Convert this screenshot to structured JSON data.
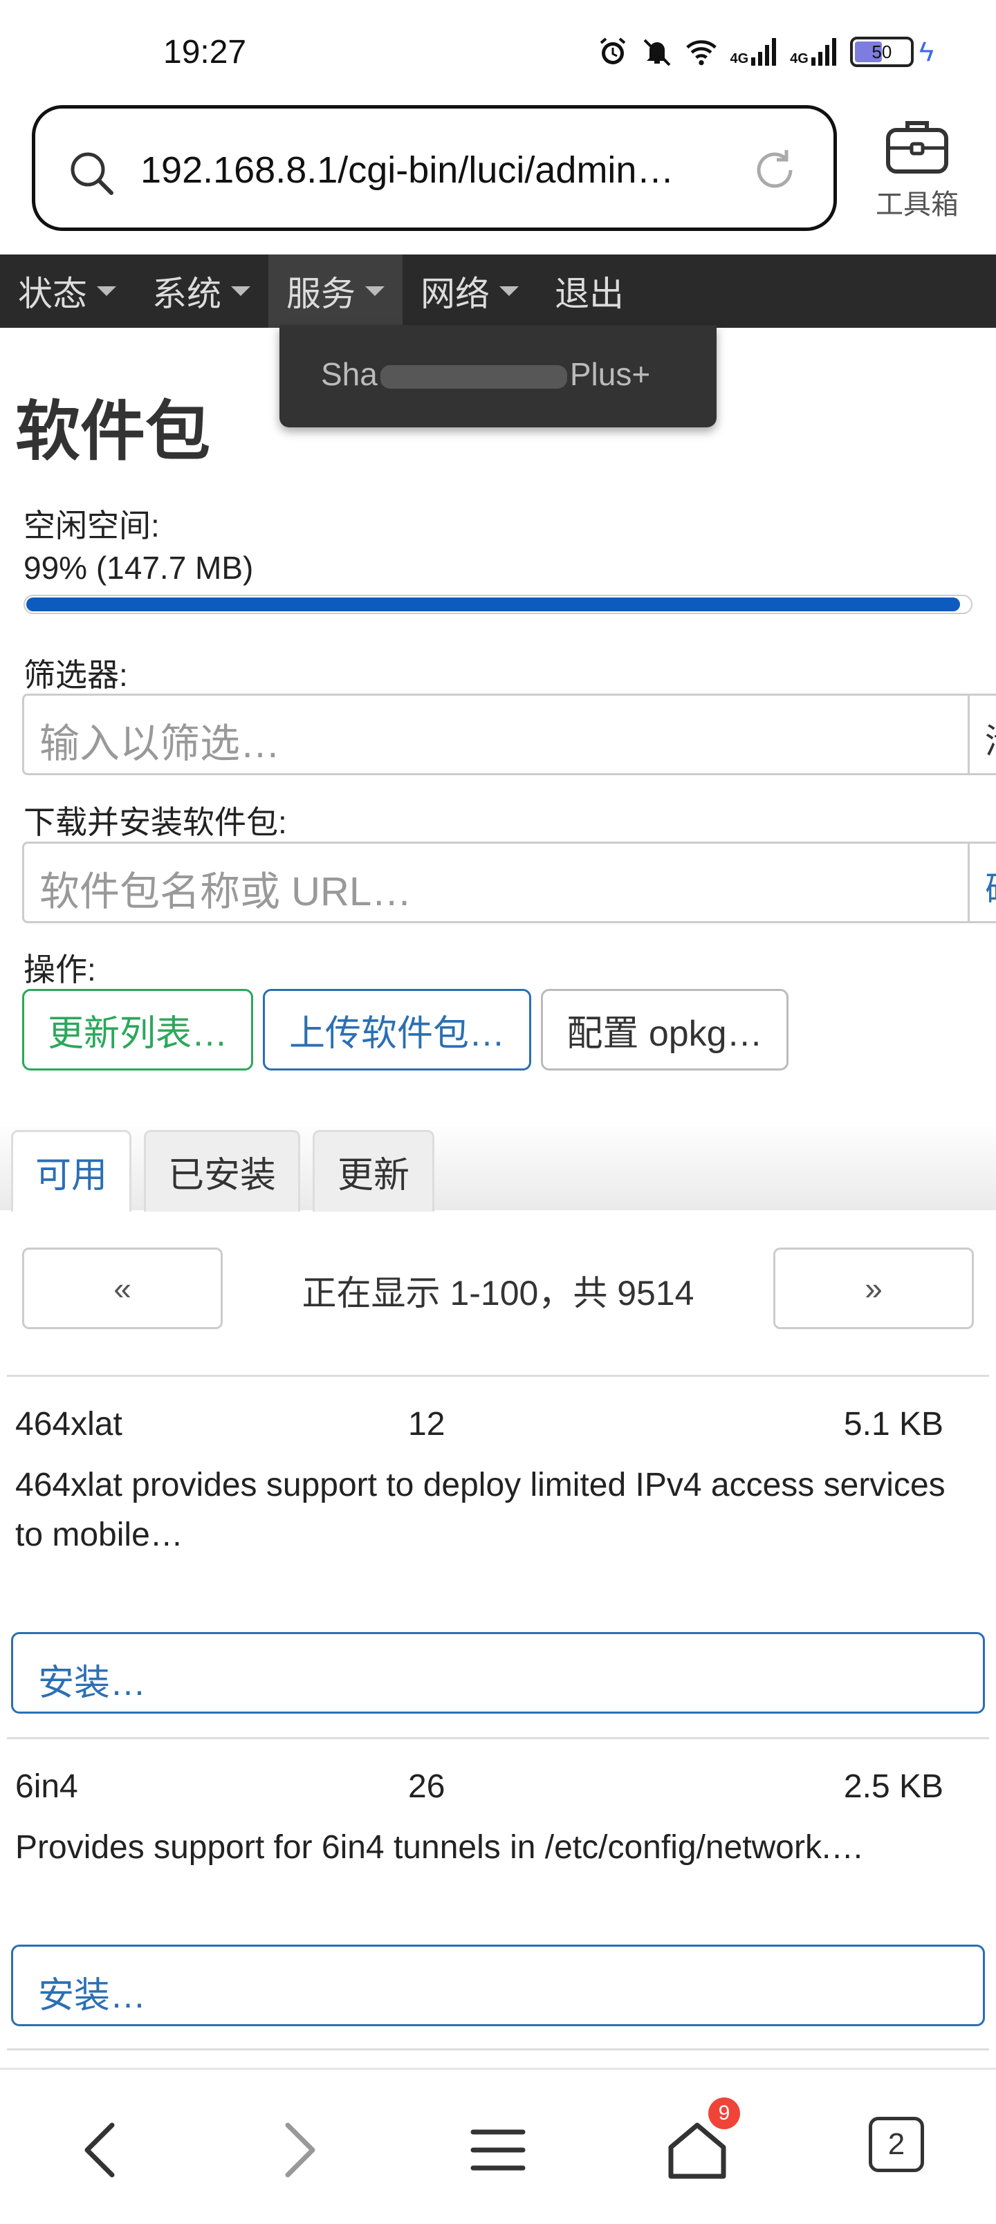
{
  "status_bar": {
    "time": "19:27",
    "net1": "4G",
    "net2": "4G",
    "battery": "50",
    "icons": [
      "alarm-icon",
      "mute-icon",
      "wifi-icon",
      "signal-icon",
      "signal-icon",
      "battery-icon",
      "charging-icon"
    ]
  },
  "browser": {
    "url": "192.168.8.1/cgi-bin/luci/admin…",
    "toolbox_label": "工具箱"
  },
  "nav": {
    "items": [
      "状态",
      "系统",
      "服务",
      "网络",
      "退出"
    ]
  },
  "dropdown": {
    "item_prefix": "Sha",
    "item_suffix": "Plus+"
  },
  "page": {
    "title": "软件包",
    "free_space_label": "空闲空间:",
    "free_space_value": "99% (147.7 MB)",
    "free_space_percent": 99,
    "filter_label": "筛选器:",
    "filter_placeholder": "输入以筛选…",
    "filter_button_partial": "清",
    "download_label": "下载并安装软件包:",
    "download_placeholder": "软件包名称或 URL…",
    "download_button_partial": "确",
    "actions_label": "操作:",
    "actions": {
      "update": "更新列表…",
      "upload": "上传软件包…",
      "configure": "配置 opkg…"
    }
  },
  "tabs": [
    "可用",
    "已安装",
    "更新"
  ],
  "pager": {
    "prev": "«",
    "next": "»",
    "text": "正在显示 1-100，共 9514"
  },
  "packages": [
    {
      "name": "464xlat",
      "version": "12",
      "size": "5.1 KB",
      "description": "464xlat provides support to deploy limited IPv4 access services to mobile…",
      "install": "安装…"
    },
    {
      "name": "6in4",
      "version": "26",
      "size": "2.5 KB",
      "description": "Provides support for 6in4 tunnels in /etc/config/network.…",
      "install": "安装…"
    }
  ],
  "bottom_nav": {
    "tabs_count": "2",
    "home_badge": "9"
  },
  "colors": {
    "accent_blue": "#2b6fb4",
    "accent_green": "#2aa85a",
    "navbar": "#2a2a2a",
    "progress": "#0d5bbf"
  }
}
